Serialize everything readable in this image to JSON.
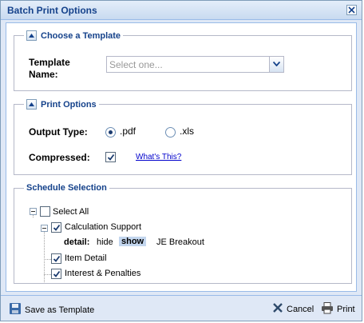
{
  "dialog": {
    "title": "Batch Print Options"
  },
  "template_section": {
    "legend": "Choose a Template",
    "label_line1": "Template",
    "label_line2": "Name:",
    "placeholder": "Select one..."
  },
  "print_section": {
    "legend": "Print Options",
    "output_label": "Output Type:",
    "output_options": [
      ".pdf",
      ".xls"
    ],
    "output_selected": ".pdf",
    "compressed_label": "Compressed:",
    "compressed_checked": true,
    "help_link": "What's This?"
  },
  "schedule_section": {
    "legend": "Schedule Selection",
    "select_all": "Select All",
    "calc_support": "Calculation Support",
    "detail_label": "detail:",
    "detail_options": [
      "hide",
      "show",
      "JE Breakout"
    ],
    "detail_selected": "show",
    "item_detail": "Item Detail",
    "interest": "Interest & Penalties"
  },
  "footer": {
    "save_template": "Save as Template",
    "cancel": "Cancel",
    "print": "Print"
  }
}
